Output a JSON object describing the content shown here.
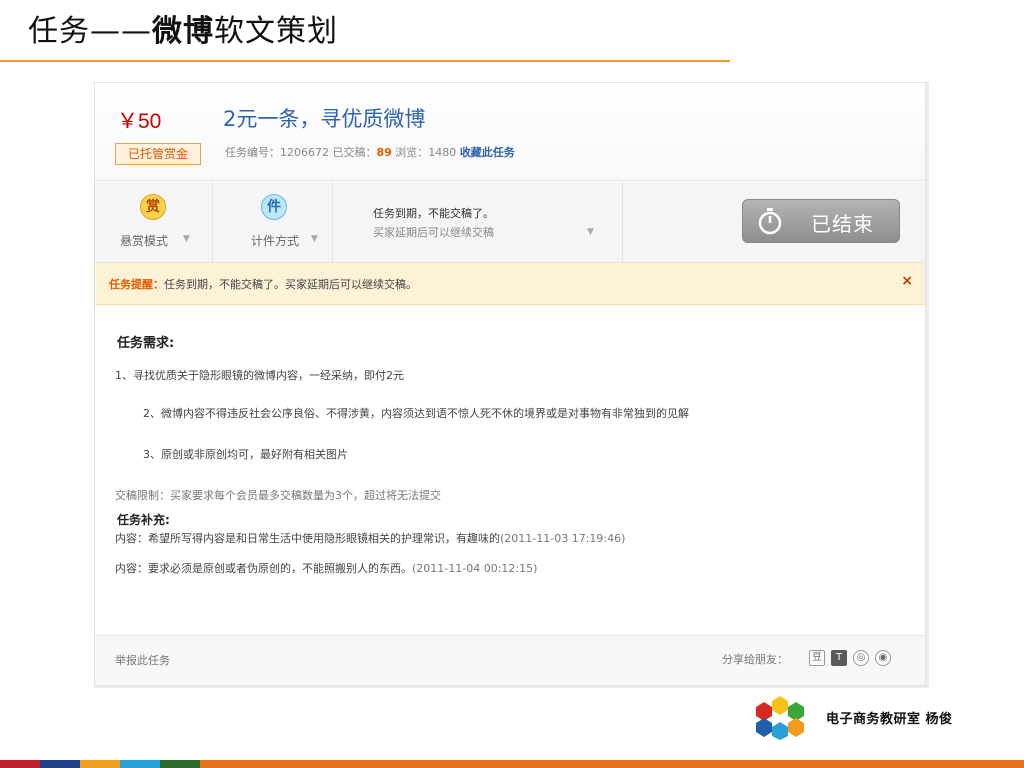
{
  "slide": {
    "title_part1": "任务——",
    "title_part2": "微博",
    "title_part3": "软文策划"
  },
  "task": {
    "price": "￥50",
    "escrow_label": "已托管赏金",
    "title": "2元一条，寻优质微博",
    "meta_prefix": "任务编号：1206672  已交稿：",
    "submitted": "89",
    "meta_views": " 浏览：1480 ",
    "favorite": "收藏此任务"
  },
  "modes": {
    "reward_icon": "赏",
    "reward_label": "悬赏模式",
    "piece_icon": "件",
    "piece_label": "计件方式",
    "deadline_line1": "任务到期，不能交稿了。",
    "deadline_line2": "买家延期后可以继续交稿",
    "status_button": "已结束"
  },
  "notice": {
    "key": "任务提醒：",
    "text": "任务到期，不能交稿了。买家延期后可以继续交稿。",
    "close": "×"
  },
  "requirements": {
    "title": "任务需求:",
    "items": [
      "1、寻找优质关于隐形眼镜的微博内容，一经采纳，即付2元",
      "2、微博内容不得违反社会公序良俗、不得涉黄，内容须达到语不惊人死不休的境界或是对事物有非常独到的见解",
      "3、原创或非原创均可，最好附有相关图片"
    ],
    "limit": "交稿限制：买家要求每个会员最多交稿数量为3个，超过将无法提交"
  },
  "supplement": {
    "title": "任务补充:",
    "entries": [
      {
        "label": "内容：",
        "text": "希望所写得内容是和日常生活中使用隐形眼镜相关的护理常识，有趣味的",
        "time": "(2011-11-03 17:19:46)"
      },
      {
        "label": "内容：",
        "text": "要求必须是原创或者伪原创的，不能照搬别人的东西。",
        "time": "(2011-11-04 00:12:15)"
      }
    ]
  },
  "footer": {
    "report": "举报此任务",
    "share_label": "分享给朋友："
  },
  "author": "电子商务教研室   杨俊",
  "colors": {
    "accent_orange": "#f29b1e",
    "price_red": "#cc0000",
    "link_blue": "#2c62b1",
    "bar": [
      "#c0202a",
      "#1f3f87",
      "#f0a020",
      "#2a9fd6",
      "#2d6a2a",
      "#e8731e"
    ]
  },
  "icons": [
    "reward-icon",
    "piece-icon",
    "stopwatch-icon",
    "close-icon",
    "share-douban-icon",
    "share-t-icon",
    "share-renren-icon",
    "share-weibo-icon",
    "logo-icon"
  ]
}
